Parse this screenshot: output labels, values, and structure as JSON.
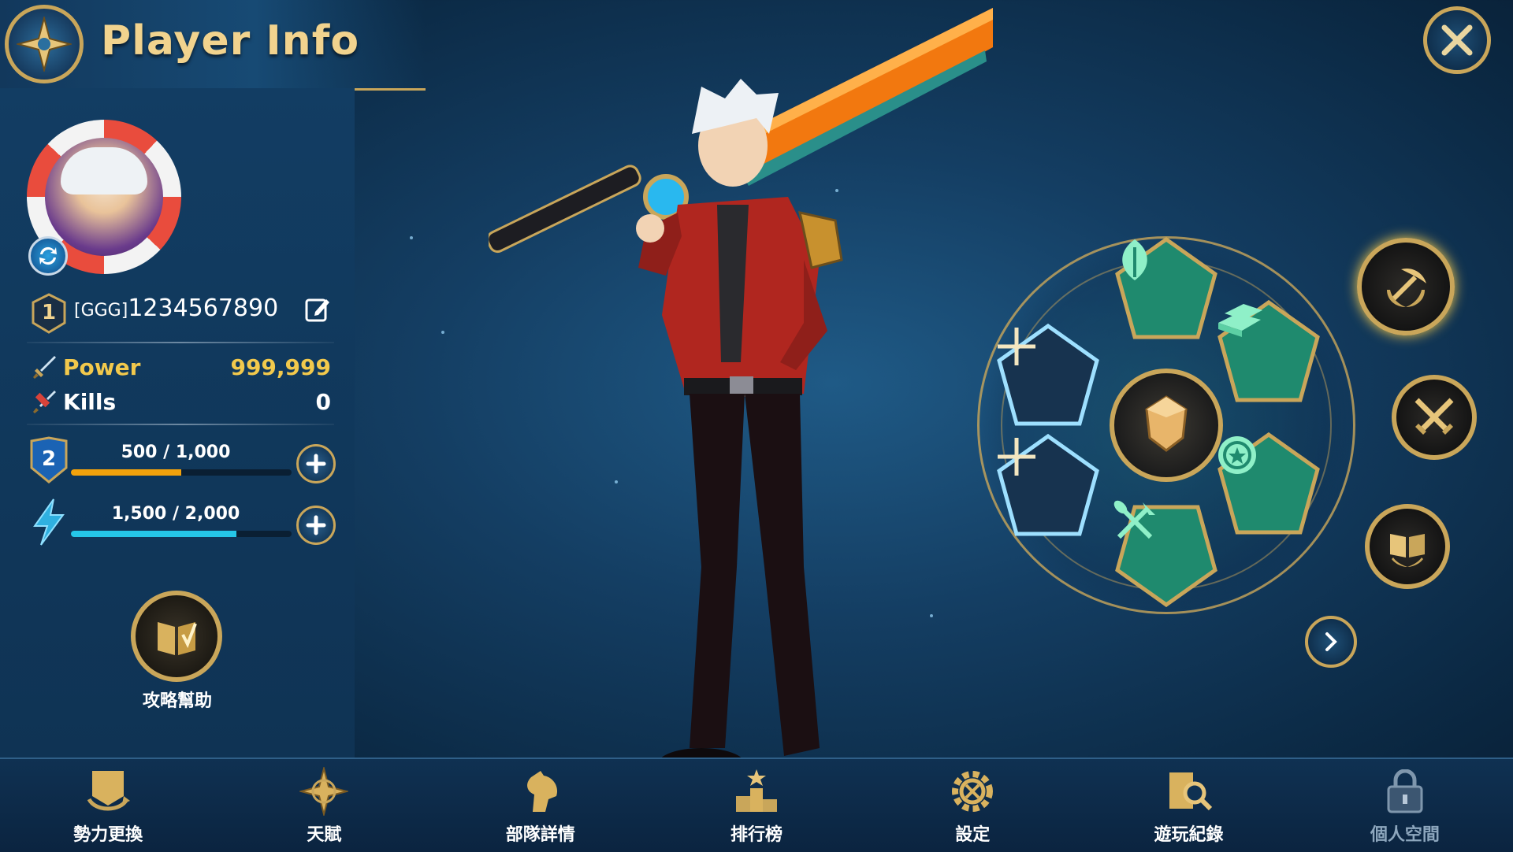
{
  "header": {
    "title": "Player Info"
  },
  "player": {
    "level": "1",
    "tag": "[GGG]",
    "name": "1234567890"
  },
  "stats": [
    {
      "label": "Power",
      "value": "999,999"
    },
    {
      "label": "Kills",
      "value": "0"
    }
  ],
  "bars": [
    {
      "badge": "2",
      "text": "500 / 1,000",
      "fill": 0.5,
      "color": "#f2a20c"
    },
    {
      "text": "1,500 / 2,000",
      "fill": 0.75,
      "color": "#25c6e8"
    }
  ],
  "guide": {
    "label": "攻略幫助"
  },
  "nav": [
    {
      "label": "勢力更換",
      "icon": "faction-swap-icon"
    },
    {
      "label": "天賦",
      "icon": "compass-star-icon"
    },
    {
      "label": "部隊詳情",
      "icon": "horse-head-icon"
    },
    {
      "label": "排行榜",
      "icon": "podium-icon"
    },
    {
      "label": "設定",
      "icon": "gear-icon"
    },
    {
      "label": "遊玩紀錄",
      "icon": "record-search-icon"
    },
    {
      "label": "個人空間",
      "icon": "lock-icon"
    }
  ],
  "colors": {
    "gold": "#c9a65a",
    "title": "#f1d38e",
    "stat_value": "#f2c94c",
    "teal": "#1f8a6e"
  }
}
